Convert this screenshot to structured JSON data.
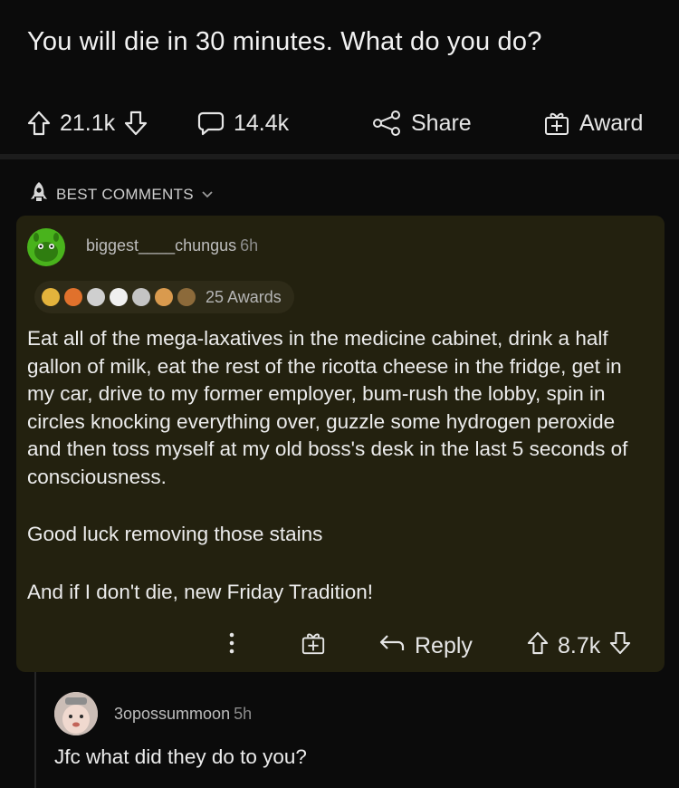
{
  "post": {
    "title": "You will die in 30 minutes. What do you do?",
    "upvotes": "21.1k",
    "comments": "14.4k",
    "share_label": "Share",
    "award_label": "Award"
  },
  "sort": {
    "label": "BEST COMMENTS"
  },
  "top_comment": {
    "username": "biggest____chungus",
    "time": "6h",
    "awards_label": "25 Awards",
    "paragraphs": [
      "Eat all of the mega-laxatives in the medicine cabinet, drink a half gallon of milk, eat the rest of the ricotta cheese in the fridge, get in my car, drive to my former employer, bum-rush the lobby, spin in circles knocking everything over, guzzle some hydrogen peroxide and then toss myself at my old boss's desk in the last 5 seconds of consciousness.",
      "Good luck removing those stains",
      "And if I don't die, new Friday Tradition!"
    ],
    "reply_label": "Reply",
    "votes": "8.7k"
  },
  "reply_comment": {
    "username": "3opossummoon",
    "time": "5h",
    "text": "Jfc what did they do to you?"
  },
  "colors": {
    "background": "#0b0b0b",
    "comment_card": "#23210f",
    "avatar_green": "#49b31c"
  }
}
